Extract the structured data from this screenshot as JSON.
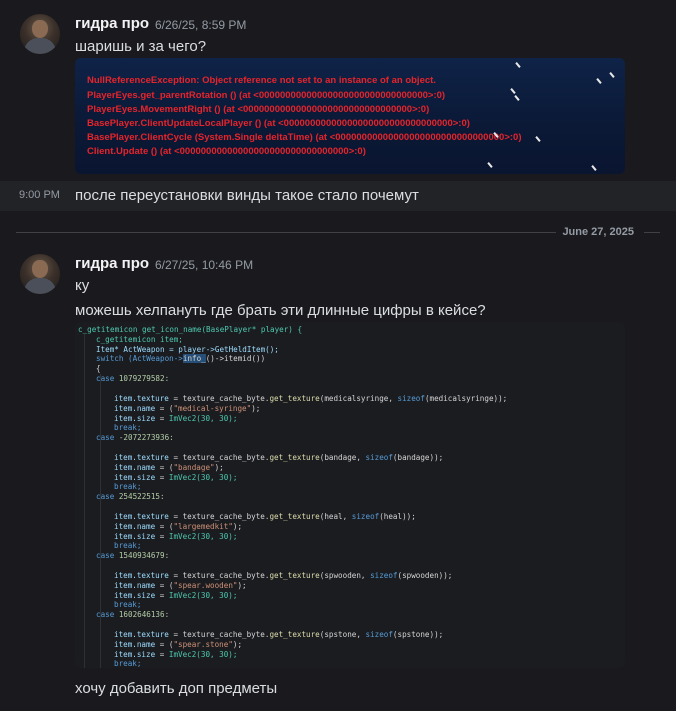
{
  "messages": [
    {
      "author": "гидра про",
      "timestamp": "6/26/25, 8:59 PM",
      "text": "шаришь и за чего?",
      "error_image": {
        "lines": [
          "NullReferenceException: Object reference not set to an instance of an object.",
          "PlayerEyes.get_parentRotation () (at <00000000000000000000000000000000>:0)",
          "PlayerEyes.MovementRight () (at <00000000000000000000000000000000>:0)",
          "BasePlayer.ClientUpdateLocalPlayer () (at <00000000000000000000000000000000>:0)",
          "BasePlayer.ClientCycle (System.Single deltaTime) (at <00000000000000000000000000000000>:0)",
          "Client.Update () (at <00000000000000000000000000000000>:0)"
        ]
      }
    },
    {
      "side_time": "9:00 PM",
      "text": "после переустановки винды такое стало почемут"
    },
    {
      "author": "гидра про",
      "timestamp": "6/27/25, 10:46 PM",
      "lines": [
        "ку",
        "можешь хелпануть где брать эти длинные цифры в кейсе?"
      ]
    },
    {
      "text": "хочу добавить доп предметы"
    }
  ],
  "date_divider": "June 27, 2025",
  "code_image": {
    "signature": "c_getitemicon get_icon_name(BasePlayer* player) {",
    "decl1": "c_getitemicon item;",
    "decl2": "Item* ActWeapon = player->GetHeldItem();",
    "switch_pre": "switch (ActWeapon->",
    "switch_sel": "info_",
    "switch_post": "()->itemid())",
    "open_brace": "{",
    "cases": [
      {
        "value": "1079279582",
        "texture": "medicalsyringe",
        "name": "medical-syringe"
      },
      {
        "value": "-2072273936",
        "texture": "bandage",
        "name": "bandage"
      },
      {
        "value": "254522515",
        "texture": "heal",
        "name": "largemedkit"
      },
      {
        "value": "1540934679",
        "texture": "spwooden",
        "name": "spear.wooden"
      },
      {
        "value": "1602646136",
        "texture": "spstone",
        "name": "spear.stone"
      }
    ],
    "size_value": "ImVec2(30, 30);",
    "break_kw": "break;",
    "trailing": "break;"
  }
}
